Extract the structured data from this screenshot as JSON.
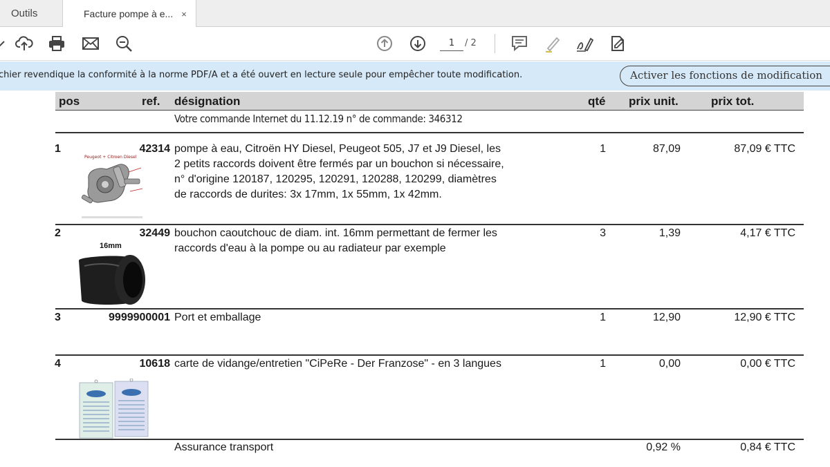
{
  "tabs": [
    {
      "label": "Outils"
    },
    {
      "label": "Facture pompe à e...",
      "close": "×"
    }
  ],
  "toolbar": {
    "current_page": "1",
    "total_pages": "/ 2"
  },
  "infobar": {
    "message": "chier revendique la conformité à la norme PDF/A et a été ouvert en lecture seule pour empêcher toute modification.",
    "button_label": "Activer les fonctions de modification"
  },
  "invoice": {
    "headers": {
      "pos": "pos",
      "ref": "ref.",
      "designation": "désignation",
      "qty": "qté",
      "unit_price": "prix unit.",
      "total_price": "prix tot."
    },
    "order_note": "Votre commande Internet du 11.12.19 n° de commande: 346312",
    "rows": [
      {
        "pos": "1",
        "ref": "42314",
        "designation_lines": [
          "pompe à eau, Citroën HY Diesel, Peugeot 505, J7 et J9 Diesel, les",
          "2 petits raccords doivent être fermés par un bouchon si nécessaire,",
          "n° d'origine 120187, 120295, 120291, 120288, 120299, diamètres",
          "de raccords de durites: 3x 17mm, 1x 55mm, 1x 42mm."
        ],
        "qty": "1",
        "unit_price": "87,09",
        "total_price": "87,09 € TTC",
        "image_caption": "Peugeot + Citroen Diesel"
      },
      {
        "pos": "2",
        "ref": "32449",
        "designation_lines": [
          "bouchon caoutchouc de diam. int. 16mm permettant de fermer les",
          "raccords d'eau à la pompe ou au radiateur par exemple"
        ],
        "qty": "3",
        "unit_price": "1,39",
        "total_price": "4,17 € TTC",
        "image_caption": "16mm"
      },
      {
        "pos": "3",
        "ref": "9999900001",
        "designation_lines": [
          "Port et emballage"
        ],
        "qty": "1",
        "unit_price": "12,90",
        "total_price": "12,90 € TTC"
      },
      {
        "pos": "4",
        "ref": "10618",
        "designation_lines": [
          "carte de vidange/entretien \"CiPeRe - Der Franzose\" - en 3 langues"
        ],
        "qty": "1",
        "unit_price": "0,00",
        "total_price": "0,00 € TTC"
      }
    ],
    "insurance": {
      "label": "Assurance transport",
      "rate": "0,92 %",
      "total": "0,84 € TTC"
    }
  },
  "colors": {
    "infobar_bg": "#d6e9f8",
    "header_bg": "#d4d4d4",
    "icon_gray": "#444444"
  },
  "icons": [
    "chevron-down-icon",
    "cloud-upload-icon",
    "print-icon",
    "mail-icon",
    "zoom-icon",
    "page-up-icon",
    "page-down-icon",
    "comment-icon",
    "highlight-icon",
    "sign-icon",
    "fill-sign-icon"
  ]
}
